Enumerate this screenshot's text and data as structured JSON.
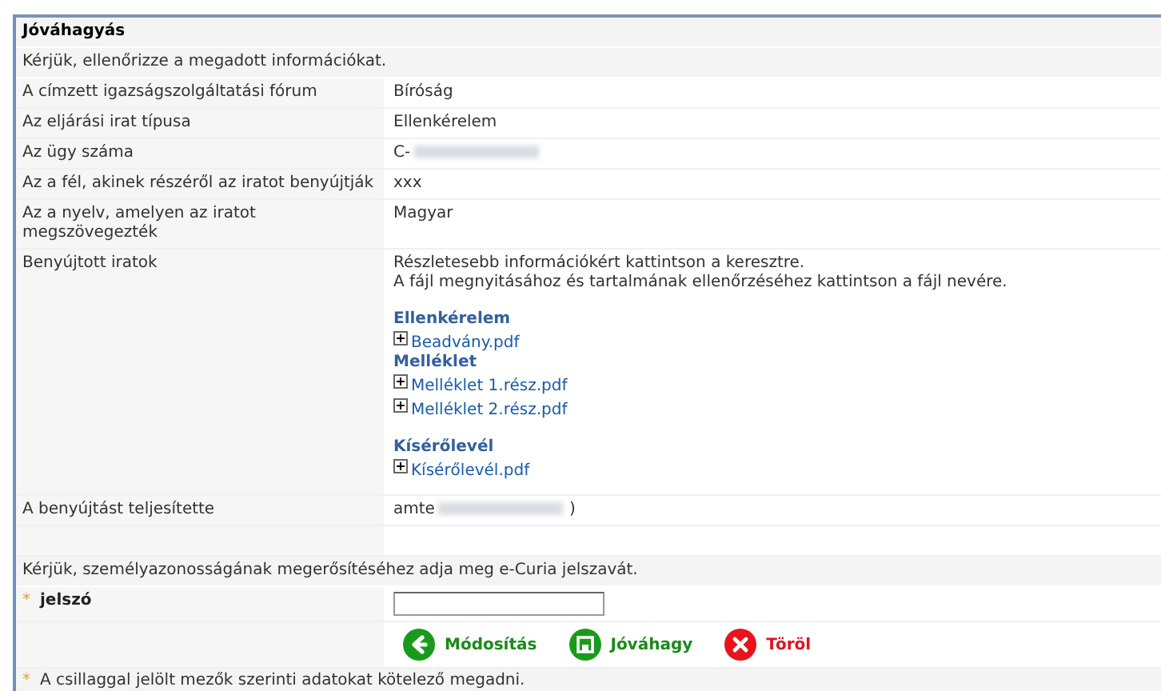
{
  "panel": {
    "title": "Jóváhagyás",
    "intro": "Kérjük, ellenőrizze a megadott információkat."
  },
  "fields": [
    {
      "label": "A címzett igazságszolgáltatási fórum",
      "value": "Bíróság",
      "redacted": false
    },
    {
      "label": "Az eljárási irat típusa",
      "value": "Ellenkérelem",
      "redacted": false
    },
    {
      "label": "Az ügy száma",
      "value": "C-",
      "redacted": true
    },
    {
      "label": "Az a fél, akinek részéről az iratot benyújtják",
      "value": "xxx",
      "redacted": false
    },
    {
      "label": "Az a nyelv, amelyen az iratot megszövegezték",
      "value": "Magyar",
      "redacted": false
    }
  ],
  "documents": {
    "label": "Benyújtott iratok",
    "hints": [
      "Részletesebb információkért kattintson a keresztre.",
      "A fájl megnyitásához és tartalmának ellenőrzéséhez kattintson a fájl nevére."
    ],
    "groups": [
      {
        "title": "Ellenkérelem",
        "gap_before": true,
        "files": [
          "Beadvány.pdf"
        ]
      },
      {
        "title": "Melléklet",
        "gap_before": false,
        "files": [
          "Melléklet 1.rész.pdf",
          "Melléklet 2.rész.pdf"
        ]
      },
      {
        "title": "Kísérőlevél",
        "gap_before": true,
        "files": [
          "Kísérőlevél.pdf"
        ]
      }
    ]
  },
  "submitter": {
    "label": "A benyújtást teljesítette",
    "value": "amte",
    "redacted": true,
    "value_after": ")"
  },
  "auth": {
    "intro": "Kérjük, személyazonosságának megerősítéséhez adja meg e-Curia jelszavát.",
    "required_mark": "*",
    "label": "jelszó"
  },
  "buttons": [
    {
      "kind": "back",
      "label": "Módosítás"
    },
    {
      "kind": "save",
      "label": "Jóváhagy"
    },
    {
      "kind": "delete",
      "label": "Töröl"
    }
  ],
  "footer": {
    "mark": "*",
    "note": "A csillaggal jelölt mezők szerinti adatokat kötelező megadni."
  }
}
